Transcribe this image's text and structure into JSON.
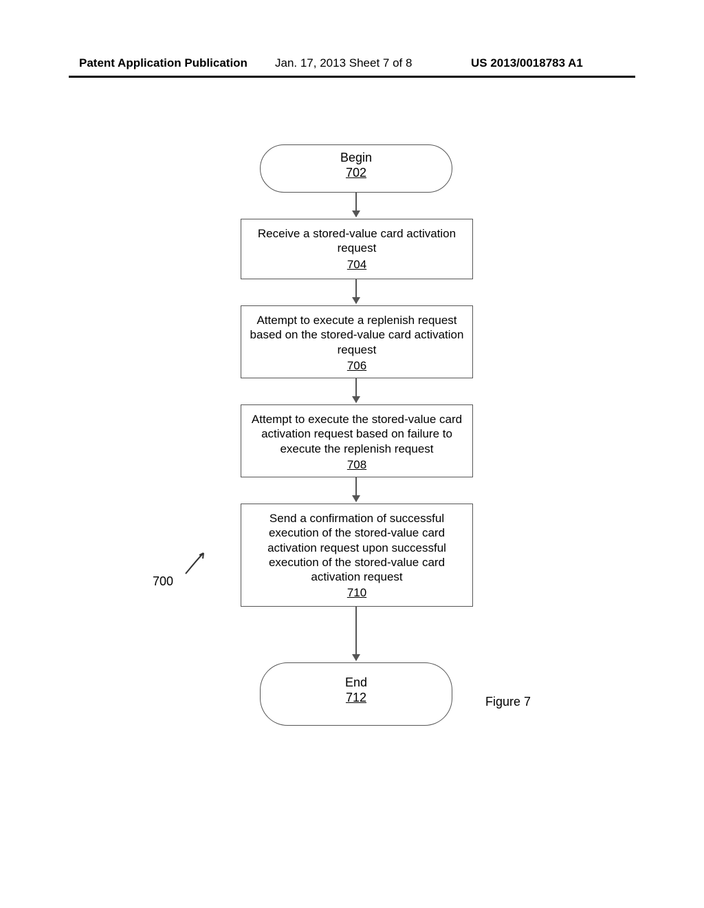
{
  "header": {
    "left": "Patent Application Publication",
    "center": "Jan. 17, 2013  Sheet 7 of 8",
    "right": "US 2013/0018783 A1"
  },
  "flowchart": {
    "index_number": "700",
    "figure_label": "Figure 7",
    "nodes": {
      "begin": {
        "label": "Begin",
        "ref": "702"
      },
      "step704": {
        "text": "Receive a stored-value card activation request",
        "ref": "704"
      },
      "step706": {
        "text": "Attempt to execute a replenish request based on the stored-value card activation request",
        "ref": "706"
      },
      "step708": {
        "text": "Attempt to execute the stored-value card activation request based on failure to execute the replenish request",
        "ref": "708"
      },
      "step710": {
        "text": "Send a confirmation of successful execution of the stored-value card activation request upon successful execution of the stored-value card activation request",
        "ref": "710"
      },
      "end": {
        "label": "End",
        "ref": "712"
      }
    }
  },
  "chart_data": {
    "type": "flowchart",
    "title": "Figure 7",
    "index": "700",
    "nodes": [
      {
        "id": "702",
        "shape": "terminator",
        "text": "Begin"
      },
      {
        "id": "704",
        "shape": "process",
        "text": "Receive a stored-value card activation request"
      },
      {
        "id": "706",
        "shape": "process",
        "text": "Attempt to execute a replenish request based on the stored-value card activation request"
      },
      {
        "id": "708",
        "shape": "process",
        "text": "Attempt to execute the stored-value card activation request based on failure to execute the replenish request"
      },
      {
        "id": "710",
        "shape": "process",
        "text": "Send a confirmation of successful execution of the stored-value card activation request upon successful execution of the stored-value card activation request"
      },
      {
        "id": "712",
        "shape": "terminator",
        "text": "End"
      }
    ],
    "edges": [
      {
        "from": "702",
        "to": "704"
      },
      {
        "from": "704",
        "to": "706"
      },
      {
        "from": "706",
        "to": "708"
      },
      {
        "from": "708",
        "to": "710"
      },
      {
        "from": "710",
        "to": "712"
      }
    ]
  }
}
